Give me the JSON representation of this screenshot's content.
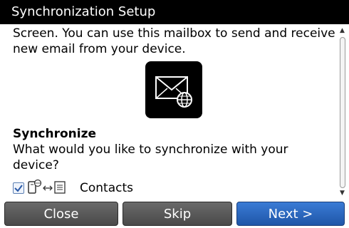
{
  "window": {
    "title": "Synchronization Setup"
  },
  "content": {
    "intro_text": "Screen. You can use this mailbox to send and receive new email from your device.",
    "app_icon": "email-globe-icon",
    "sync_heading": "Synchronize",
    "sync_question": "What would you like to synchronize with your device?",
    "contacts_option": {
      "label": "Contacts",
      "checked": true,
      "sync_icon": "phone-sync-document-icon"
    }
  },
  "buttons": {
    "close_label": "Close",
    "skip_label": "Skip",
    "next_label": "Next >"
  },
  "colors": {
    "titlebar_bg": "#000000",
    "button_gray": "#555555",
    "button_blue": "#2c66c0"
  }
}
